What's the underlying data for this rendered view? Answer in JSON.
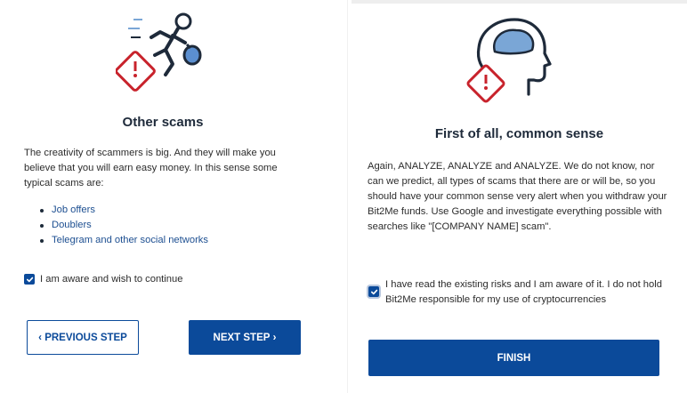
{
  "colors": {
    "primary": "#0b4a9a",
    "link": "#1d4f91",
    "warning_red": "#c8232c"
  },
  "left": {
    "illustration_icon": "running-thief-with-warning-sign",
    "title": "Other scams",
    "intro": "The creativity of scammers is big. And they will make you believe that you will earn easy money. In this sense some typical scams are:",
    "scams": [
      "Job offers",
      "Doublers",
      "Telegram and other social networks"
    ],
    "checkbox_label": "I am aware and wish to continue",
    "checkbox_checked": true,
    "prev_label": "PREVIOUS STEP",
    "next_label": "NEXT STEP"
  },
  "right": {
    "illustration_icon": "head-with-brain-warning-sign",
    "title": "First of all, common sense",
    "body": "Again, ANALYZE, ANALYZE and ANALYZE. We do not know, nor can we predict, all types of scams that there are or will be, so you should have your common sense very alert when you withdraw your Bit2Me funds. Use Google and investigate everything possible with searches like \"[COMPANY NAME] scam\".",
    "checkbox_label": "I have read the existing risks and I am aware of it. I do not hold Bit2Me responsible for my use of cryptocurrencies",
    "checkbox_checked": true,
    "finish_label": "FINISH"
  }
}
